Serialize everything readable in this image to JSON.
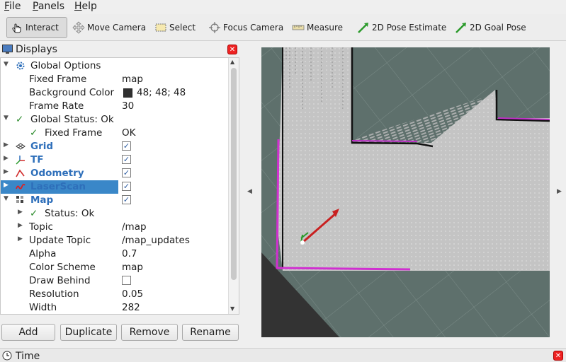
{
  "menu": [
    {
      "label": "File",
      "key": "F",
      "rest": "ile"
    },
    {
      "label": "Panels",
      "key": "P",
      "rest": "anels"
    },
    {
      "label": "Help",
      "key": "H",
      "rest": "elp"
    }
  ],
  "toolbar": {
    "interact": "Interact",
    "move_camera": "Move Camera",
    "select": "Select",
    "focus_camera": "Focus Camera",
    "measure": "Measure",
    "pose_estimate": "2D Pose Estimate",
    "goal_pose": "2D Goal Pose"
  },
  "displays": {
    "title": "Displays",
    "global_options": {
      "label": "Global Options",
      "fixed_frame_label": "Fixed Frame",
      "fixed_frame": "map",
      "bg_color_label": "Background Color",
      "bg_color": "48; 48; 48",
      "bg_swatch": "#303030",
      "frame_rate_label": "Frame Rate",
      "frame_rate": "30"
    },
    "global_status": {
      "label": "Global Status: Ok",
      "fixed_frame_label": "Fixed Frame",
      "fixed_frame": "OK"
    },
    "items": [
      {
        "label": "Grid",
        "checked": true
      },
      {
        "label": "TF",
        "checked": true
      },
      {
        "label": "Odometry",
        "checked": true
      },
      {
        "label": "LaserScan",
        "checked": true
      },
      {
        "label": "Map",
        "checked": true
      }
    ],
    "map": {
      "status_label": "Status: Ok",
      "topic_label": "Topic",
      "topic": "/map",
      "update_topic_label": "Update Topic",
      "update_topic": "/map_updates",
      "alpha_label": "Alpha",
      "alpha": "0.7",
      "color_scheme_label": "Color Scheme",
      "color_scheme": "map",
      "draw_behind_label": "Draw Behind",
      "resolution_label": "Resolution",
      "resolution": "0.05",
      "width_label": "Width",
      "width": "282"
    },
    "buttons": {
      "add": "Add",
      "duplicate": "Duplicate",
      "remove": "Remove",
      "rename": "Rename"
    }
  },
  "time_panel": {
    "title": "Time"
  },
  "colors": {
    "selection": "#3a87c8",
    "map_border": "#d030d0",
    "free_space": "#c4c4c4",
    "grid_bg": "#5c6e6a"
  }
}
